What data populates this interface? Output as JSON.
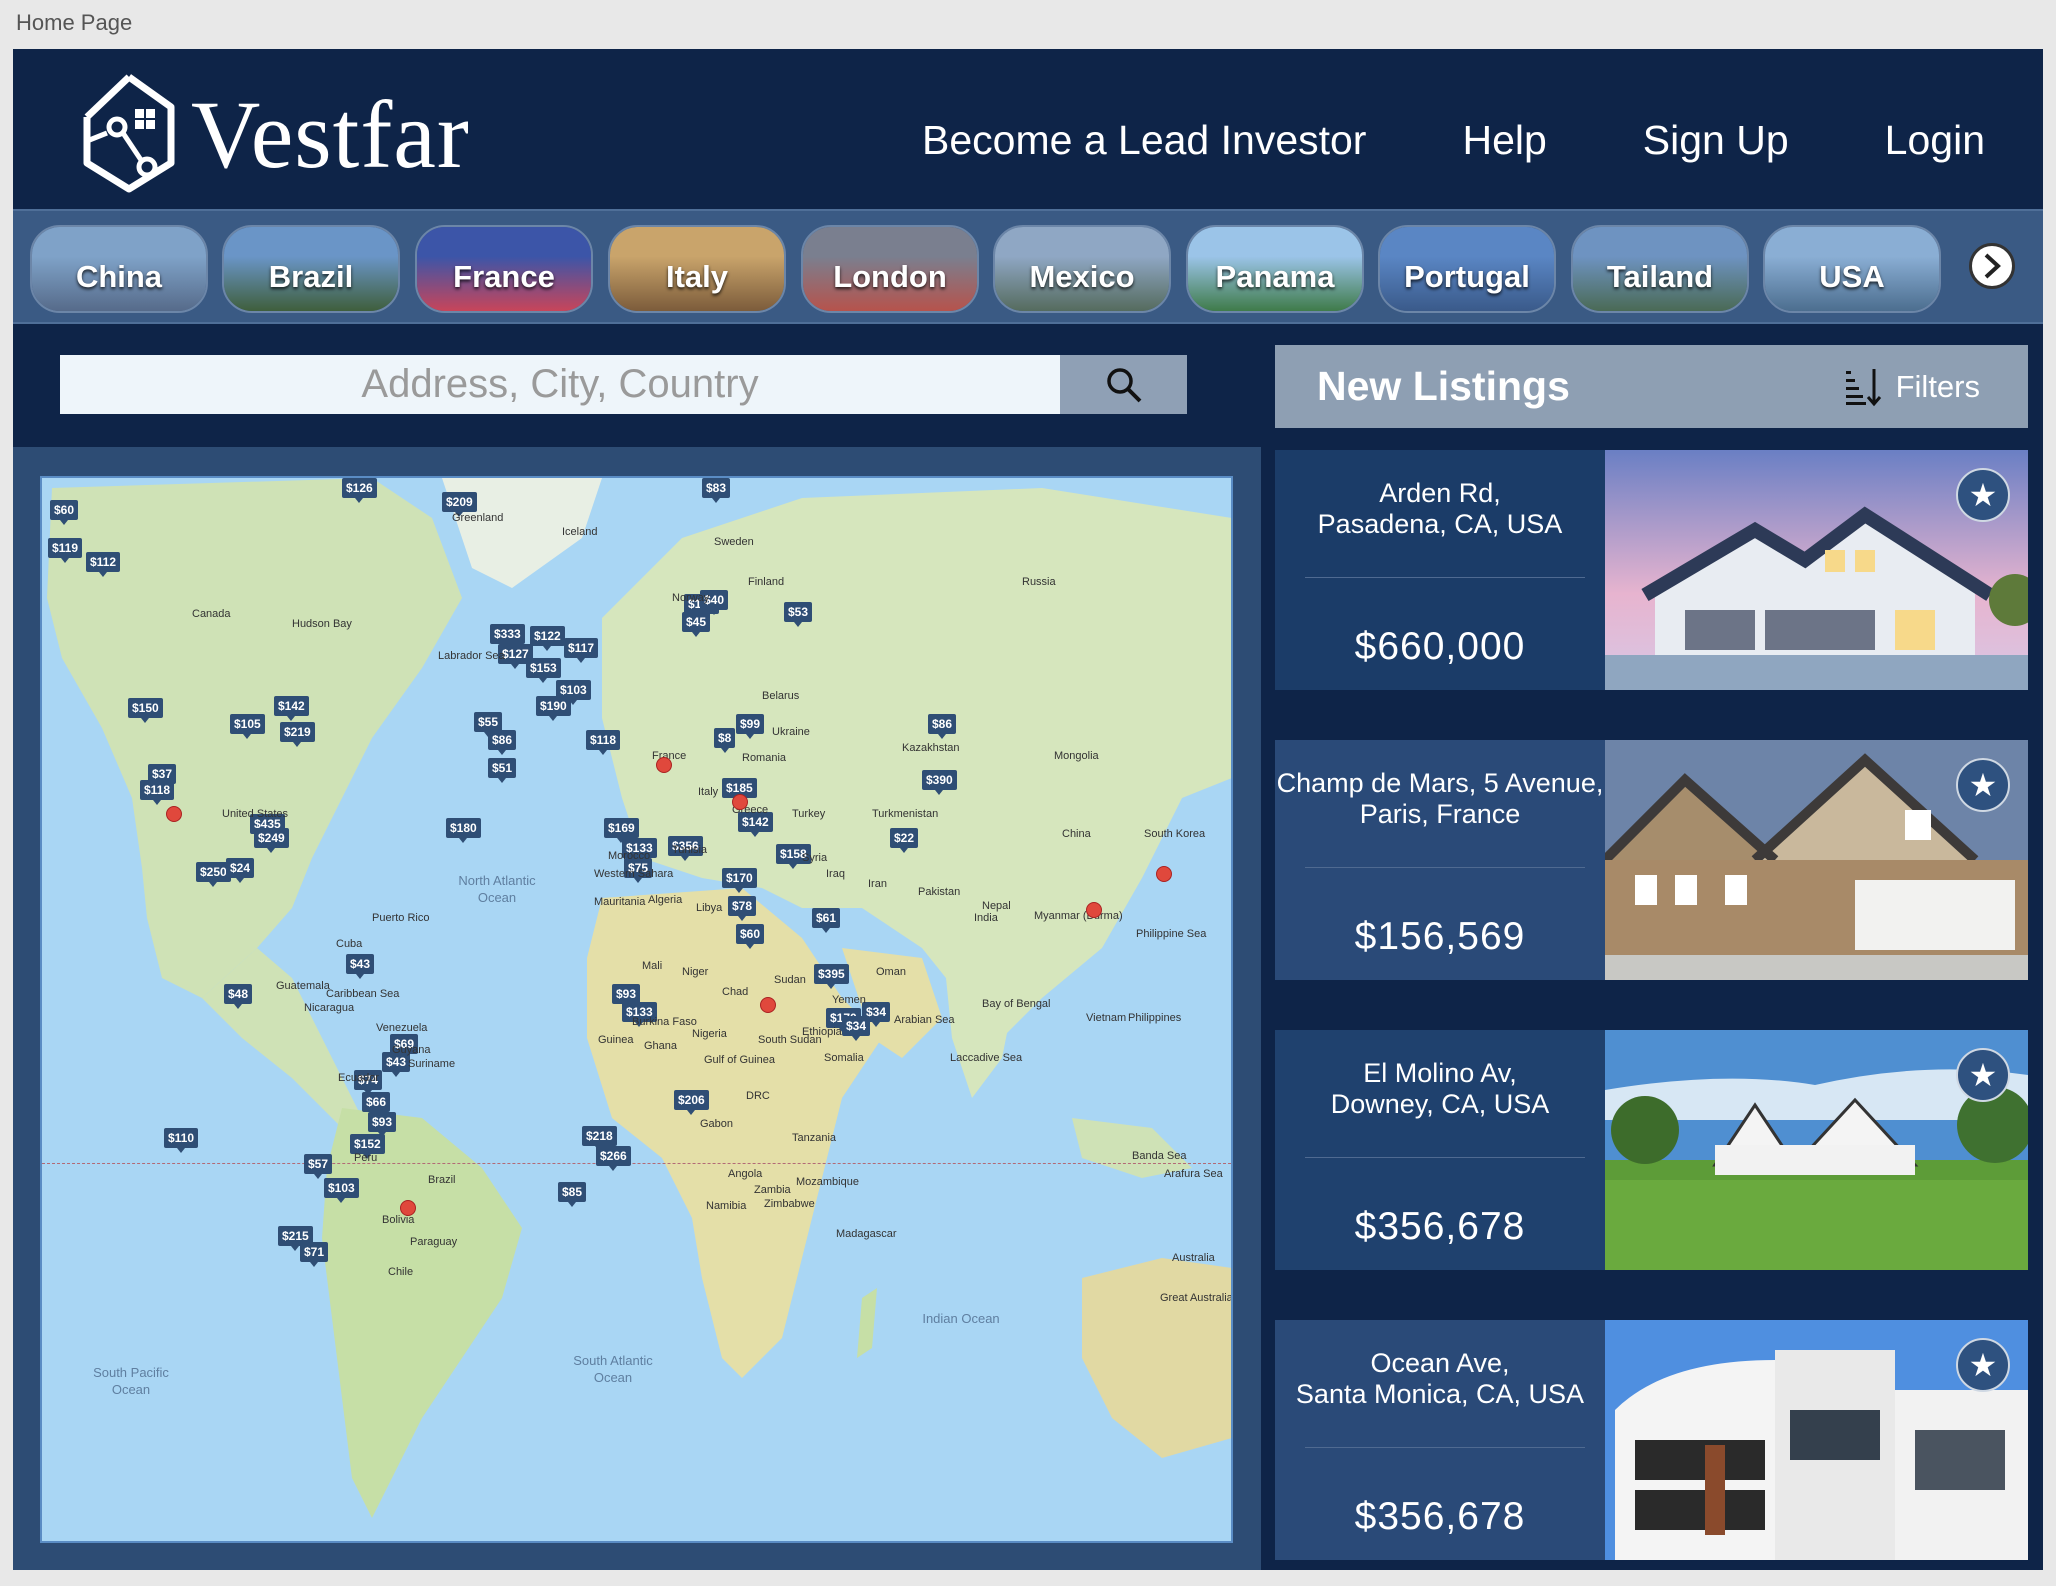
{
  "page_label": "Home Page",
  "brand": {
    "name": "Vestfar"
  },
  "nav": [
    {
      "label": "Become a Lead Investor"
    },
    {
      "label": "Help"
    },
    {
      "label": "Sign Up"
    },
    {
      "label": "Login"
    }
  ],
  "countries": [
    {
      "label": "China",
      "colors": [
        "#7fa2c8",
        "#566b8a"
      ]
    },
    {
      "label": "Brazil",
      "colors": [
        "#6a95c7",
        "#3f5f3c"
      ]
    },
    {
      "label": "France",
      "colors": [
        "#3c55a8",
        "#c8455a"
      ]
    },
    {
      "label": "Italy",
      "colors": [
        "#c9a46b",
        "#7c5c3b"
      ]
    },
    {
      "label": "London",
      "colors": [
        "#7a7f8f",
        "#b6534c"
      ]
    },
    {
      "label": "Mexico",
      "colors": [
        "#8fa7c4",
        "#556b5e"
      ]
    },
    {
      "label": "Panama",
      "colors": [
        "#9bc4e8",
        "#3f7b4a"
      ]
    },
    {
      "label": "Portugal",
      "colors": [
        "#5a86c4",
        "#3a5a8a"
      ]
    },
    {
      "label": "Tailand",
      "colors": [
        "#6e93c1",
        "#4a6a55"
      ]
    },
    {
      "label": "USA",
      "colors": [
        "#8aaed4",
        "#4c6e8f"
      ]
    }
  ],
  "search": {
    "placeholder": "Address, City, Country"
  },
  "listings": {
    "title": "New Listings",
    "filters_label": "Filters",
    "items": [
      {
        "addr1": "Arden Rd,",
        "addr2": "Pasadena, CA, USA",
        "price": "$660,000"
      },
      {
        "addr1": "Champ de Mars, 5 Avenue,",
        "addr2": "Paris, France",
        "price": "$156,569"
      },
      {
        "addr1": "El Molino Av,",
        "addr2": "Downey, CA, USA",
        "price": "$356,678"
      },
      {
        "addr1": "Ocean Ave,",
        "addr2": "Santa Monica, CA, USA",
        "price": "$356,678"
      }
    ]
  },
  "map": {
    "pins": [
      "$60",
      "$119",
      "$112",
      "$126",
      "$209",
      "$83",
      "$333",
      "$122",
      "$117",
      "$127",
      "$153",
      "$100",
      "$40",
      "$45",
      "$53",
      "$103",
      "$150",
      "$105",
      "$142",
      "$219",
      "$190",
      "$55",
      "$118",
      "$86",
      "$51",
      "$99",
      "$8",
      "$86",
      "$390",
      "$37",
      "$118",
      "$185",
      "$180",
      "$169",
      "$133",
      "$75",
      "$356",
      "$142",
      "$435",
      "$249",
      "$158",
      "$22",
      "$250",
      "$24",
      "$170",
      "$78",
      "$60",
      "$61",
      "$43",
      "$395",
      "$48",
      "$93",
      "$133",
      "$170",
      "$34",
      "$34",
      "$69",
      "$43",
      "$74",
      "$66",
      "$93",
      "$206",
      "$110",
      "$218",
      "$152",
      "$266",
      "$57",
      "$103",
      "$85",
      "$215",
      "$71"
    ],
    "labels": [
      "Greenland",
      "Iceland",
      "Sweden",
      "Finland",
      "Norway",
      "Russia",
      "Canada",
      "Hudson Bay",
      "Labrador Sea",
      "Belarus",
      "Ukraine",
      "Kazakhstan",
      "Mongolia",
      "France",
      "Romania",
      "Italy",
      "Greece",
      "Turkey",
      "Turkmenistan",
      "United States",
      "China",
      "South Korea",
      "Morocco",
      "Tunisia",
      "Syria",
      "Iraq",
      "Iran",
      "Algeria",
      "Libya",
      "Pakistan",
      "Nepal",
      "India",
      "Myanmar (Burma)",
      "Mali",
      "Niger",
      "Chad",
      "Sudan",
      "Yemen",
      "Oman",
      "Vietnam",
      "Philippines",
      "Nigeria",
      "Ethiopia",
      "Somalia",
      "South Sudan",
      "Venezuela",
      "Guyana",
      "Suriname",
      "Ecuador",
      "Peru",
      "Brazil",
      "Bolivia",
      "Paraguay",
      "Chile",
      "DRC",
      "Tanzania",
      "Angola",
      "Zambia",
      "Mozambique",
      "Namibia",
      "Zimbabwe",
      "Madagascar",
      "Australia",
      "Puerto Rico",
      "Cuba",
      "Guatemala",
      "Nicaragua",
      "Caribbean Sea",
      "Arabian Sea",
      "Bay of Bengal",
      "Gulf of Guinea",
      "Philippine Sea",
      "Banda Sea",
      "Arafura Sea",
      "Laccadive Sea",
      "Western Sahara",
      "Mauritania",
      "Burkina Faso",
      "Ghana",
      "Guinea",
      "Gabon",
      "Great Australian Bight"
    ],
    "oceans": [
      "North Atlantic Ocean",
      "South Atlantic Ocean",
      "South Pacific Ocean",
      "Indian Ocean"
    ]
  }
}
